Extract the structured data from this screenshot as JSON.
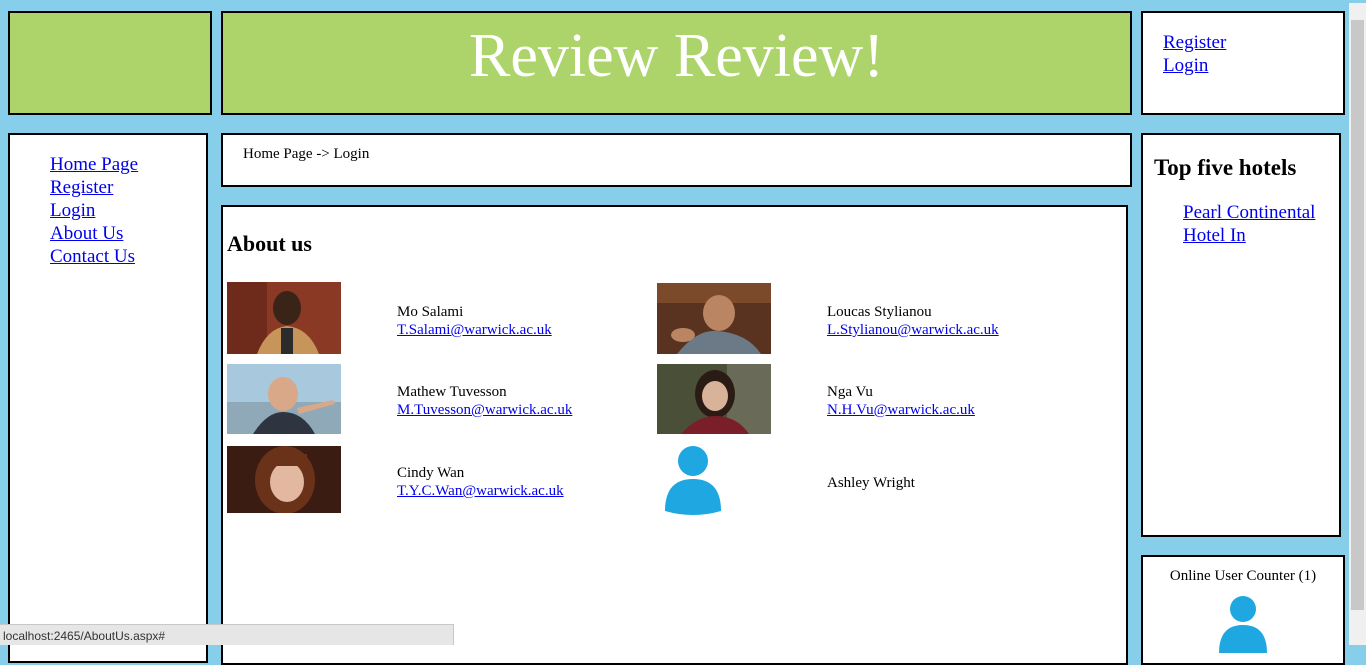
{
  "header": {
    "title": "Review Review!"
  },
  "auth": {
    "register": "Register",
    "login": "Login"
  },
  "nav": {
    "items": [
      {
        "label": "Home Page"
      },
      {
        "label": "Register"
      },
      {
        "label": "Login"
      },
      {
        "label": "About Us"
      },
      {
        "label": "Contact Us"
      }
    ]
  },
  "breadcrumb": "Home Page -> Login",
  "about": {
    "title": "About us",
    "members": [
      {
        "name": "Mo Salami",
        "email": "T.Salami@warwick.ac.uk",
        "photo": "person-photo"
      },
      {
        "name": "Loucas Stylianou",
        "email": "L.Stylianou@warwick.ac.uk",
        "photo": "person-photo"
      },
      {
        "name": "Mathew Tuvesson",
        "email": "M.Tuvesson@warwick.ac.uk",
        "photo": "person-photo"
      },
      {
        "name": "Nga Vu",
        "email": "N.H.Vu@warwick.ac.uk",
        "photo": "person-photo"
      },
      {
        "name": "Cindy Wan",
        "email": "T.Y.C.Wan@warwick.ac.uk",
        "photo": "person-photo"
      },
      {
        "name": "Ashley Wright",
        "email": "",
        "photo": "user-icon"
      }
    ]
  },
  "hotels": {
    "title": "Top five hotels",
    "items": [
      {
        "label": "Pearl Continental Hotel In"
      }
    ]
  },
  "counter": {
    "label": "Online User Counter",
    "count": "(1)"
  },
  "status_bar": {
    "url": "localhost:2465/AboutUs.aspx#"
  },
  "colors": {
    "background": "#87ceeb",
    "banner": "#acd46b",
    "link": "#0000ee",
    "user_icon": "#1ea7e1"
  }
}
